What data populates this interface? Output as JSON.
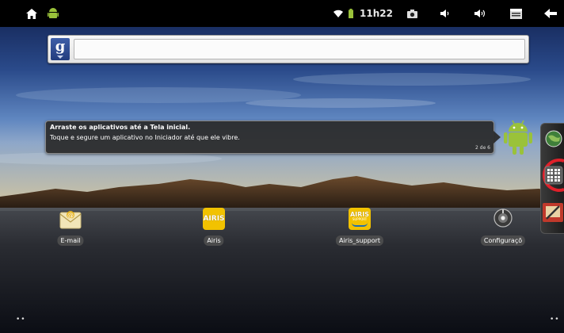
{
  "status_bar": {
    "time": "11h22",
    "icons": [
      "home-icon",
      "android-notification-icon",
      "wifi-icon",
      "battery-icon",
      "screenshot-icon",
      "volume-down-icon",
      "volume-up-icon",
      "menu-icon",
      "back-icon"
    ]
  },
  "search": {
    "provider_glyph": "g",
    "placeholder": ""
  },
  "tooltip": {
    "title": "Arraste os aplicativos até a Tela inicial.",
    "body": "Toque e segure um aplicativo no Iniciador até que ele vibre.",
    "page_indicator": "2 de 6"
  },
  "shortcuts": [
    {
      "label": "E-mail",
      "icon": "email-icon"
    },
    {
      "label": "Airis",
      "icon": "airis-icon",
      "icon_text": "AIRIS"
    },
    {
      "label": "Airis_support",
      "icon": "airis-support-icon",
      "icon_text": "AIRIS",
      "icon_subtext": "SUPPORT"
    },
    {
      "label": "Configuraçõ",
      "icon": "settings-icon"
    }
  ],
  "page_dots": {
    "left": "••",
    "right": "••"
  },
  "colors": {
    "status_bar": "#000000",
    "highlight_circle": "#e0202a",
    "android_green": "#9ac23a",
    "airis_yellow": "#f2c200"
  }
}
